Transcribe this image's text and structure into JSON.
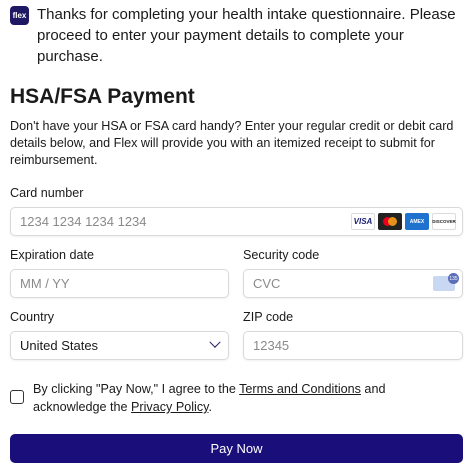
{
  "banner": {
    "logo_text": "flex",
    "message": "Thanks for completing your health intake questionnaire. Please proceed to enter your payment details to complete your purchase."
  },
  "payment": {
    "title": "HSA/FSA Payment",
    "description": "Don't have your HSA or FSA card handy? Enter your regular credit or debit card details below, and Flex will provide you with an itemized receipt to submit for reimbursement.",
    "card_number": {
      "label": "Card number",
      "placeholder": "1234 1234 1234 1234"
    },
    "card_brands": {
      "visa": "VISA",
      "amex": "AMEX",
      "discover": "DISCOVER"
    },
    "expiration": {
      "label": "Expiration date",
      "placeholder": "MM / YY"
    },
    "security": {
      "label": "Security code",
      "placeholder": "CVC",
      "icon_badge": "135"
    },
    "country": {
      "label": "Country",
      "value": "United States"
    },
    "zip": {
      "label": "ZIP code",
      "placeholder": "12345"
    }
  },
  "agreement": {
    "prefix": "By clicking \"Pay Now,\" I agree to the ",
    "terms_link": "Terms and Conditions",
    "middle": " and acknowledge the ",
    "privacy_link": "Privacy Policy",
    "suffix": "."
  },
  "pay_button": {
    "label": "Pay Now"
  },
  "colors": {
    "brand": "#1a0f7a",
    "border": "#d9d9d9"
  }
}
